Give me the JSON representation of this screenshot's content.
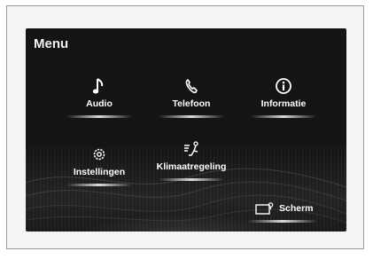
{
  "menu": {
    "title": "Menu",
    "items": [
      {
        "label": "Audio",
        "icon": "music-note-icon"
      },
      {
        "label": "Telefoon",
        "icon": "phone-icon"
      },
      {
        "label": "Informatie",
        "icon": "info-icon"
      },
      {
        "label": "Instellingen",
        "icon": "gear-icon"
      },
      {
        "label": "Klimaatregeling",
        "icon": "climate-icon"
      }
    ],
    "screen_button": {
      "label": "Scherm",
      "icon": "screen-icon"
    }
  },
  "colors": {
    "background": "#141414",
    "text": "#ffffff"
  }
}
